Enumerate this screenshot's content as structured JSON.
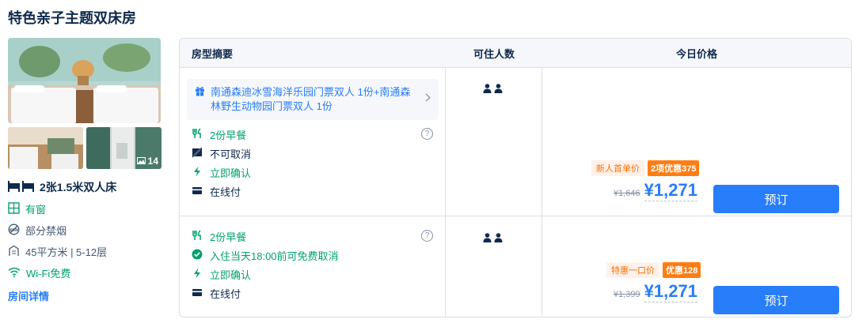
{
  "room": {
    "title": "特色亲子主题双床房",
    "photo_count": "14",
    "bed": "2张1.5米双人床",
    "facilities": [
      {
        "icon": "window-icon",
        "text": "有窗"
      },
      {
        "icon": "no-smoking-icon",
        "text": "部分禁烟"
      },
      {
        "icon": "area-floor-icon",
        "text": "45平方米 | 5-12层"
      },
      {
        "icon": "wifi-icon",
        "text": "Wi-Fi免费"
      }
    ],
    "detail_link": "房间详情"
  },
  "table": {
    "headers": {
      "summary": "房型摘要",
      "guests": "可住人数",
      "price": "今日价格"
    }
  },
  "offers": [
    {
      "package": "南通森迪冰雪海洋乐园门票双人 1份+南通森林野生动物园门票双人 1份",
      "policies": [
        {
          "icon": "breakfast-icon",
          "text": "2份早餐",
          "color": "#00a16b"
        },
        {
          "icon": "no-cancel-icon",
          "text": "不可取消",
          "color": "#0f294d"
        },
        {
          "icon": "lightning-icon",
          "text": "立即确认",
          "color": "#00a16b"
        },
        {
          "icon": "card-icon",
          "text": "在线付",
          "color": "#0f294d"
        }
      ],
      "guests": 2,
      "badge_light": "新人首单价",
      "badge_solid": "2项优惠375",
      "original_price": "¥1,646",
      "price": "¥1,271",
      "book_label": "预订"
    },
    {
      "package": "",
      "policies": [
        {
          "icon": "breakfast-icon",
          "text": "2份早餐",
          "color": "#00a16b"
        },
        {
          "icon": "check-circle-icon",
          "text": "入住当天18:00前可免费取消",
          "color": "#00a16b"
        },
        {
          "icon": "lightning-icon",
          "text": "立即确认",
          "color": "#00a16b"
        },
        {
          "icon": "card-icon",
          "text": "在线付",
          "color": "#0f294d"
        }
      ],
      "guests": 2,
      "badge_light": "特惠一口价",
      "badge_solid": "优惠128",
      "original_price": "¥1,399",
      "price": "¥1,271",
      "book_label": "预订"
    }
  ],
  "help_symbol": "?",
  "colors": {
    "accent": "#287dfa",
    "green": "#00a16b",
    "orange": "#ff7d13"
  }
}
